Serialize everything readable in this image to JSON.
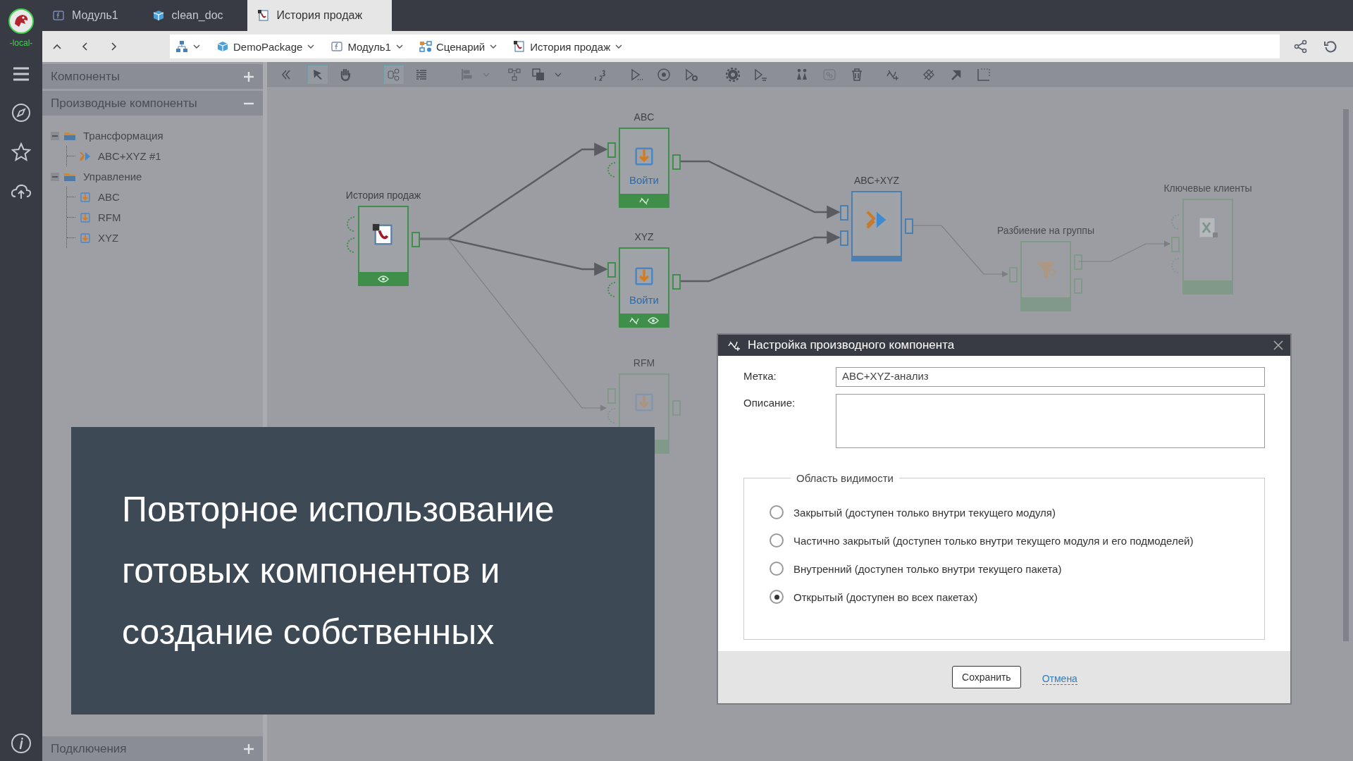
{
  "rail": {
    "server": "-local-"
  },
  "tabs": [
    {
      "kind": "module",
      "label": "Модуль1",
      "selected": false
    },
    {
      "kind": "package",
      "label": "clean_doc",
      "selected": false
    },
    {
      "kind": "scenario",
      "label": "История продаж",
      "selected": true
    }
  ],
  "breadcrumbs": [
    {
      "kind": "tree"
    },
    {
      "kind": "package",
      "label": "DemoPackage"
    },
    {
      "kind": "module",
      "label": "Модуль1"
    },
    {
      "kind": "scenario",
      "label": "Сценарий"
    },
    {
      "kind": "import",
      "label": "История продаж"
    }
  ],
  "sidebar": {
    "sections": [
      {
        "title": "Компоненты",
        "expanded": false
      },
      {
        "title": "Производные компоненты",
        "expanded": true,
        "tree": [
          {
            "kind": "folder",
            "label": "Трансформация",
            "expanded": true,
            "children": [
              {
                "kind": "merge",
                "label": "ABC+XYZ #1"
              }
            ]
          },
          {
            "kind": "folder",
            "label": "Управление",
            "expanded": true,
            "children": [
              {
                "kind": "gate",
                "label": "ABC"
              },
              {
                "kind": "gate",
                "label": "RFM"
              },
              {
                "kind": "gate",
                "label": "XYZ"
              }
            ]
          }
        ]
      }
    ],
    "footer": {
      "title": "Подключения",
      "expanded": false
    }
  },
  "toolbar": [
    {
      "kind": "collapse",
      "selected": false,
      "disabled": false
    },
    {
      "kind": "pointer",
      "selected": true,
      "disabled": false
    },
    {
      "kind": "hand",
      "selected": false,
      "disabled": false
    },
    {
      "kind": "graph",
      "selected": true,
      "disabled": false
    },
    {
      "kind": "list",
      "selected": false,
      "disabled": false
    },
    {
      "kind": "align",
      "selected": false,
      "disabled": true,
      "menu": true
    },
    {
      "kind": "layout",
      "selected": false,
      "disabled": false
    },
    {
      "kind": "arrange",
      "selected": false,
      "disabled": false,
      "menu": true
    },
    {
      "kind": "numbering",
      "selected": false,
      "disabled": false
    },
    {
      "kind": "run-all",
      "selected": false,
      "disabled": false
    },
    {
      "kind": "stop",
      "selected": false,
      "disabled": false
    },
    {
      "kind": "run-settings",
      "selected": false,
      "disabled": false
    },
    {
      "kind": "gear",
      "selected": false,
      "disabled": false
    },
    {
      "kind": "run-step",
      "selected": false,
      "disabled": false
    },
    {
      "kind": "people",
      "selected": false,
      "disabled": false
    },
    {
      "kind": "group",
      "selected": false,
      "disabled": true
    },
    {
      "kind": "trash",
      "selected": false,
      "disabled": false
    },
    {
      "kind": "derive",
      "selected": false,
      "disabled": false
    },
    {
      "kind": "link-derive",
      "selected": false,
      "disabled": false
    },
    {
      "kind": "jump",
      "selected": false,
      "disabled": false
    },
    {
      "kind": "frame",
      "selected": false,
      "disabled": false
    }
  ],
  "canvas": {
    "nodes": [
      {
        "kind": "import",
        "label": "История продаж",
        "active": true,
        "selected": false,
        "preview": true,
        "derived": false
      },
      {
        "kind": "gate",
        "label": "ABC",
        "active": true,
        "selected": false,
        "action": "Войти",
        "preview": false,
        "derived": true
      },
      {
        "kind": "gate",
        "label": "XYZ",
        "active": true,
        "selected": false,
        "action": "Войти",
        "preview": true,
        "derived": true
      },
      {
        "kind": "gate",
        "label": "RFM",
        "active": false,
        "selected": false
      },
      {
        "kind": "merge",
        "label": "ABC+XYZ",
        "active": true,
        "selected": true
      },
      {
        "kind": "filter",
        "label": "Разбиение на группы",
        "active": false,
        "selected": false,
        "preview": false,
        "derived": false
      },
      {
        "kind": "export",
        "label": "Ключевые клиенты",
        "active": false,
        "selected": false,
        "preview": false,
        "derived": false
      }
    ]
  },
  "caption": "Повторное использование готовых компонентов и создание собственных",
  "dialog": {
    "title": "Настройка производного компонента",
    "fields": [
      {
        "kind": "line",
        "label": "Метка:",
        "value": "ABC+XYZ-анализ"
      },
      {
        "kind": "area",
        "label": "Описание:"
      }
    ],
    "visibility": {
      "legend": "Область видимости",
      "options": [
        {
          "label": "Закрытый (доступен только внутри текущего модуля)",
          "selected": false
        },
        {
          "label": "Частично закрытый (доступен только внутри текущего модуля и его подмоделей)",
          "selected": false
        },
        {
          "label": "Внутренний (доступен только внутри текущего пакета)",
          "selected": false
        },
        {
          "label": "Открытый (доступен во всех пакетах)",
          "selected": true
        }
      ]
    },
    "buttons": [
      {
        "kind": "button",
        "label": "Сохранить"
      },
      {
        "kind": "link",
        "label": "Отмена"
      }
    ]
  }
}
